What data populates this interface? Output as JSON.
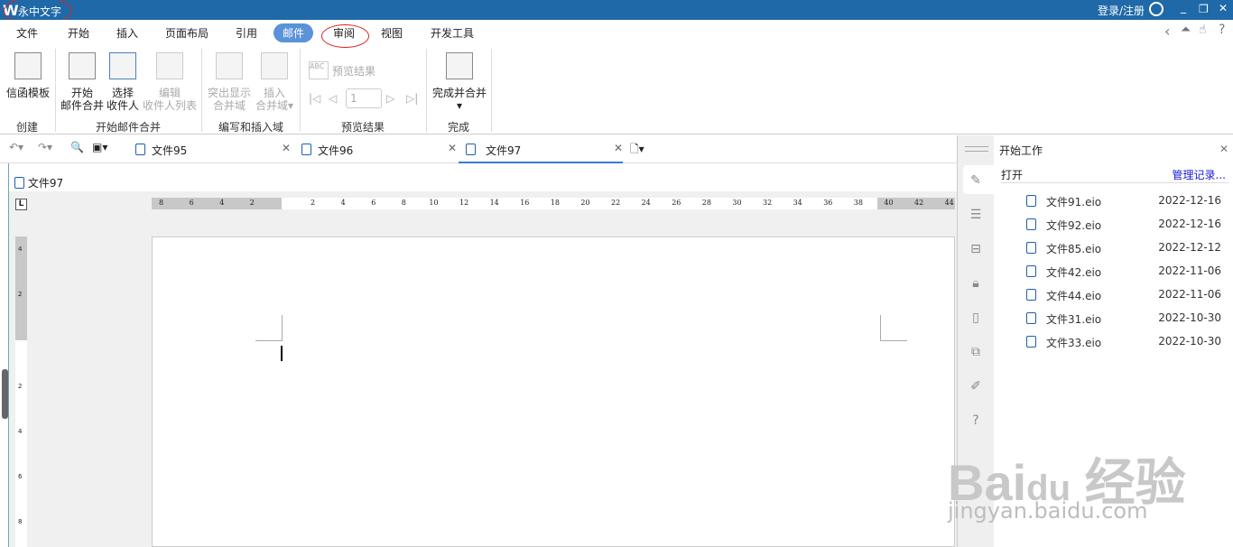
{
  "app": {
    "title": "永中文字",
    "login": "登录/注册"
  },
  "menu": [
    "文件",
    "开始",
    "插入",
    "页面布局",
    "引用",
    "邮件",
    "审阅",
    "视图",
    "开发工具"
  ],
  "ribbon": {
    "letter_template": "信函模板",
    "start_merge": [
      "开始",
      "邮件合并"
    ],
    "select_recipients": [
      "选择",
      "收件人"
    ],
    "edit_list": [
      "编辑",
      "收件人列表"
    ],
    "highlight_fields": [
      "突出显示",
      "合并域"
    ],
    "insert_field": [
      "插入",
      "合并域"
    ],
    "preview_results": "预览结果",
    "record_no": "1",
    "finish_merge": "完成并合并",
    "groups": [
      "创建",
      "开始邮件合并",
      "编写和插入域",
      "预览结果",
      "完成"
    ]
  },
  "tabs": [
    {
      "label": "文件95"
    },
    {
      "label": "文件96"
    },
    {
      "label": "文件97",
      "active": true
    }
  ],
  "doc_label": "文件97",
  "ruler": {
    "left": [
      "8",
      "6",
      "4",
      "2"
    ],
    "right": [
      "2",
      "4",
      "6",
      "8",
      "10",
      "12",
      "14",
      "16",
      "18",
      "20",
      "22",
      "24",
      "26",
      "28",
      "30",
      "32",
      "34",
      "36",
      "38",
      "40",
      "42",
      "44"
    ],
    "vertical": [
      "4",
      "2",
      "2",
      "4",
      "6",
      "8"
    ]
  },
  "panel": {
    "title": "开始工作",
    "open": "打开",
    "manage": "管理记录...",
    "recent": [
      {
        "name": "文件91.eio",
        "date": "2022-12-16"
      },
      {
        "name": "文件92.eio",
        "date": "2022-12-16"
      },
      {
        "name": "文件85.eio",
        "date": "2022-12-12"
      },
      {
        "name": "文件42.eio",
        "date": "2022-11-06"
      },
      {
        "name": "文件44.eio",
        "date": "2022-11-06"
      },
      {
        "name": "文件31.eio",
        "date": "2022-10-30"
      },
      {
        "name": "文件33.eio",
        "date": "2022-10-30"
      }
    ]
  },
  "watermark": {
    "text": "Bai du 经验",
    "url": "jingyan.baidu.com"
  }
}
